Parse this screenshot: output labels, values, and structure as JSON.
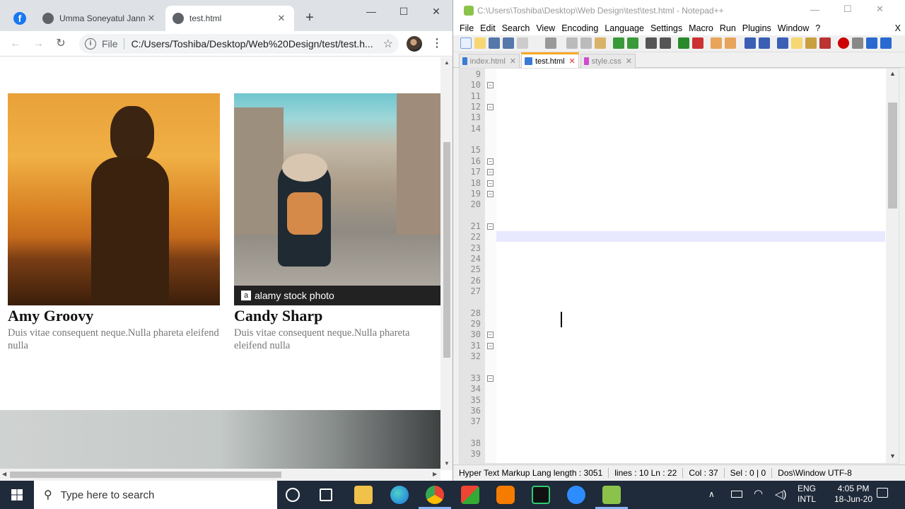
{
  "chrome": {
    "tabs": [
      {
        "title": "Umma Soneyatul Jann",
        "active": false
      },
      {
        "title": "test.html",
        "active": true
      }
    ],
    "omnibox": {
      "scheme_label": "File",
      "url": "C:/Users/Toshiba/Desktop/Web%20Design/test/test.h..."
    },
    "page": {
      "cards": [
        {
          "name": "Amy Groovy",
          "text": "Duis vitae consequent neque.Nulla phareta eleifend nulla"
        },
        {
          "name": "Candy Sharp",
          "text": "Duis vitae consequent neque.Nulla phareta eleifend nulla"
        }
      ],
      "watermark_label": "alamy stock photo"
    }
  },
  "notepad": {
    "title": "C:\\Users\\Toshiba\\Desktop\\Web Design\\test\\test.html - Notepad++",
    "menu": [
      "File",
      "Edit",
      "Search",
      "View",
      "Encoding",
      "Language",
      "Settings",
      "Macro",
      "Run",
      "Plugins",
      "Window",
      "?"
    ],
    "close_x": "X",
    "file_tabs": [
      {
        "name": "index.html",
        "active": false
      },
      {
        "name": "test.html",
        "active": true
      },
      {
        "name": "style.css",
        "active": false
      }
    ],
    "line_numbers": [
      "9",
      "10",
      "11",
      "12",
      "13",
      "14",
      "",
      "15",
      "16",
      "17",
      "18",
      "19",
      "20",
      "",
      "21",
      "22",
      "23",
      "24",
      "25",
      "26",
      "27",
      "",
      "28",
      "29",
      "30",
      "31",
      "32",
      "",
      "33",
      "34",
      "35",
      "36",
      "37",
      "",
      "38",
      "39"
    ],
    "status": {
      "lang": "Hyper Text Markup Lang length : 3051",
      "lines": "lines : 10 Ln : 22",
      "col": "Col : 37",
      "sel": "Sel : 0 | 0",
      "eol": "Dos\\Window UTF-8"
    }
  },
  "taskbar": {
    "search_placeholder": "Type here to search",
    "lang_line1": "ENG",
    "lang_line2": "INTL",
    "time": "4:05 PM",
    "date": "18-Jun-20"
  }
}
